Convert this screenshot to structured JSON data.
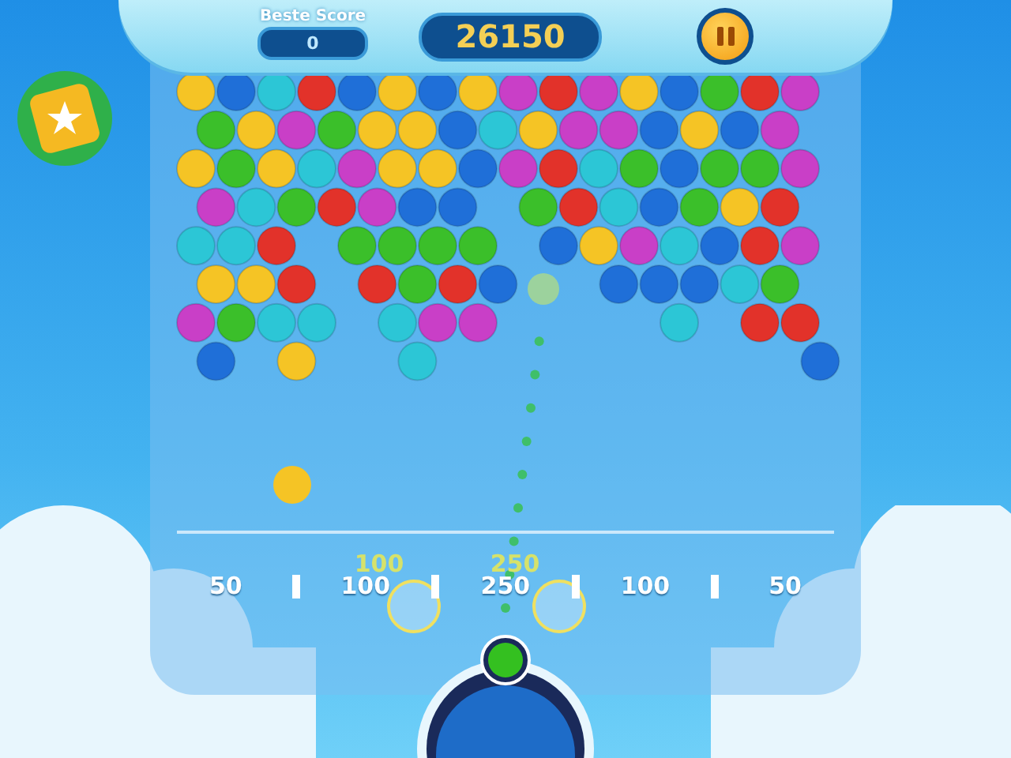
{
  "header": {
    "best_score": {
      "label": "Beste Score",
      "value": "0"
    },
    "score": "26150"
  },
  "score_zones": [
    {
      "value": "50"
    },
    {
      "value": "100"
    },
    {
      "value": "250"
    },
    {
      "value": "100"
    },
    {
      "value": "50"
    }
  ],
  "floating_points": [
    {
      "value": "100"
    },
    {
      "value": "250"
    }
  ]
}
